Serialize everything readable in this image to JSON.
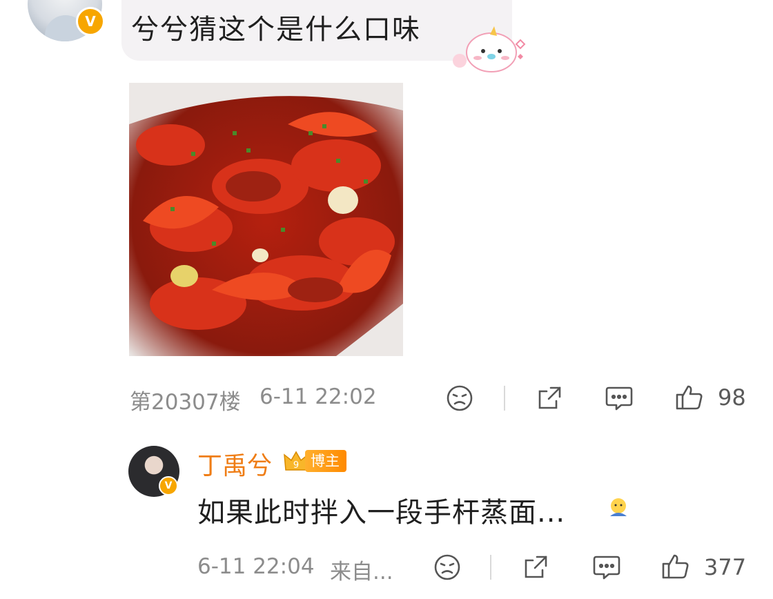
{
  "comment": {
    "verified_badge": "V",
    "text": "兮兮猜这个是什么口味",
    "floor": "第20307楼",
    "time": "6-11 22:02",
    "likes": "98",
    "icons": [
      "dislike-face-icon",
      "share-icon",
      "comment-icon",
      "thumbs-up-icon"
    ]
  },
  "reply": {
    "author": "丁禹兮",
    "author_badge": "博主",
    "level": "9",
    "verified_badge": "V",
    "text": "如果此时拌入一段手杆蒸面...",
    "time": "6-11 22:04",
    "source": "来自...",
    "likes": "377"
  },
  "colors": {
    "author_orange": "#ef7d15",
    "muted": "#8c8c8c",
    "badge_gold": "#f7a600"
  }
}
